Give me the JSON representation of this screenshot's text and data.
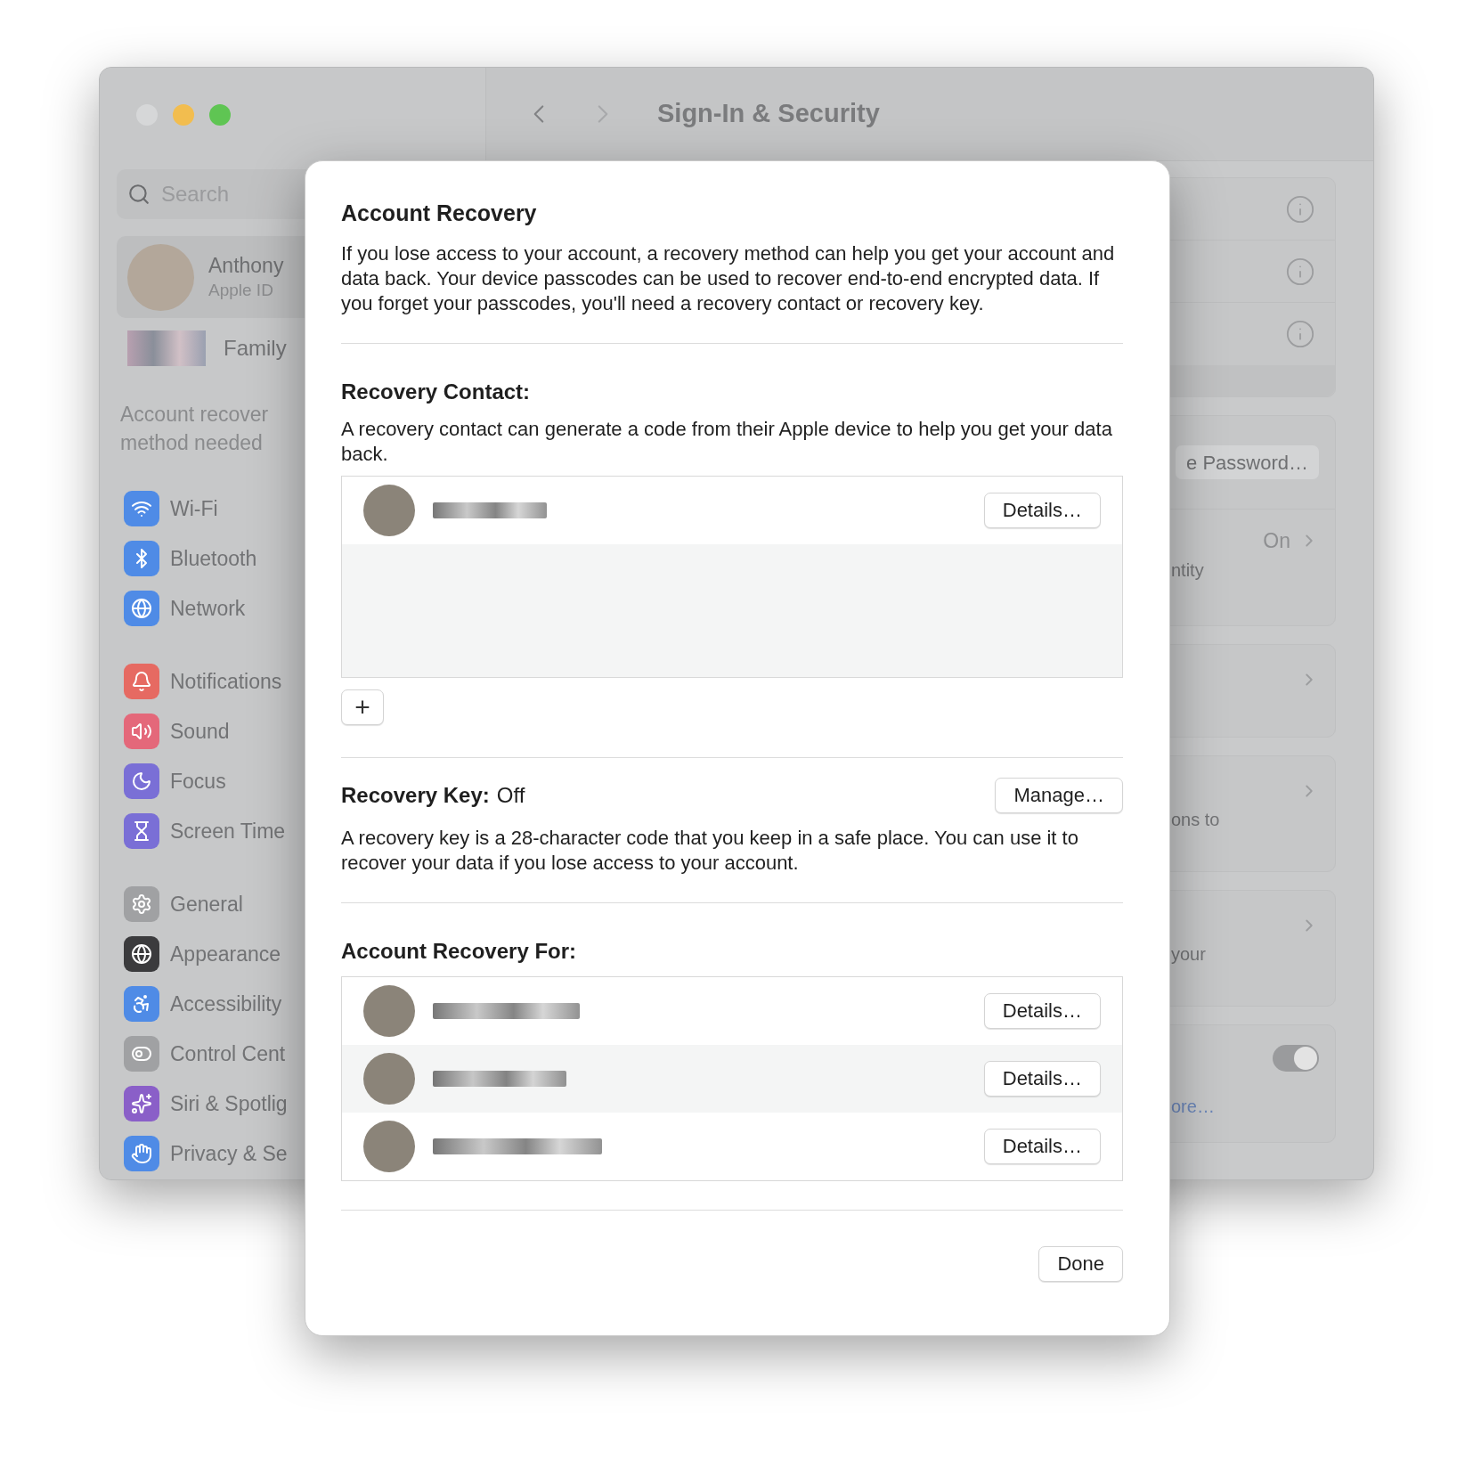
{
  "window": {
    "title": "Sign-In & Security",
    "traffic_lights": [
      {
        "color": "#d6d7d8"
      },
      {
        "color": "#f2bd4f"
      },
      {
        "color": "#5fc553"
      }
    ]
  },
  "sidebar": {
    "search": {
      "placeholder": "Search"
    },
    "account": {
      "name": "Anthony",
      "subtitle": "Apple ID"
    },
    "family": "Family",
    "notice": [
      "Account recover",
      "method needed"
    ],
    "groups": [
      [
        {
          "label": "Wi-Fi",
          "color": "#4f8be6"
        },
        {
          "label": "Bluetooth",
          "color": "#4f8be6"
        },
        {
          "label": "Network",
          "color": "#4f8be6"
        }
      ],
      [
        {
          "label": "Notifications",
          "color": "#e66a62"
        },
        {
          "label": "Sound",
          "color": "#e4687a"
        },
        {
          "label": "Focus",
          "color": "#7a6fd6"
        },
        {
          "label": "Screen Time",
          "color": "#7a6fd6"
        }
      ],
      [
        {
          "label": "General",
          "color": "#a0a1a3"
        },
        {
          "label": "Appearance",
          "color": "#3b3b3d"
        },
        {
          "label": "Accessibility",
          "color": "#4f8be6"
        },
        {
          "label": "Control Cent",
          "color": "#a0a1a3"
        },
        {
          "label": "Siri & Spotlig",
          "color": "#8a5fc8"
        },
        {
          "label": "Privacy & Se",
          "color": "#4f8be6"
        }
      ]
    ]
  },
  "panels": [
    {
      "kind": "info_list"
    },
    {
      "kind": "button_detail",
      "button": "e Password…",
      "value": "On",
      "text": "ntity"
    },
    {
      "kind": "chevron"
    },
    {
      "kind": "chevron",
      "text": "ons to"
    },
    {
      "kind": "chevron",
      "text": "your"
    },
    {
      "kind": "toggle",
      "on": true,
      "link": "ore…"
    }
  ],
  "dialog": {
    "title": "Account Recovery",
    "intro": "If you lose access to your account, a recovery method can help you get your account and data back. Your device passcodes can be used to recover end-to-end encrypted data. If you forget your passcodes, you'll need a recovery contact or recovery key.",
    "recovery_contact": {
      "heading": "Recovery Contact:",
      "description": "A recovery contact can generate a code from their Apple device to help you get your data back.",
      "contacts": [
        {
          "button": "Details…"
        }
      ],
      "add_button": "+"
    },
    "recovery_key": {
      "heading": "Recovery Key:",
      "status": "Off",
      "button": "Manage…",
      "description": "A recovery key is a 28-character code that you keep in a safe place. You can use it to recover your data if you lose access to your account."
    },
    "recovery_for": {
      "heading": "Account Recovery For:",
      "people": [
        {
          "button": "Details…"
        },
        {
          "button": "Details…"
        },
        {
          "button": "Details…"
        }
      ]
    },
    "done_button": "Done"
  }
}
